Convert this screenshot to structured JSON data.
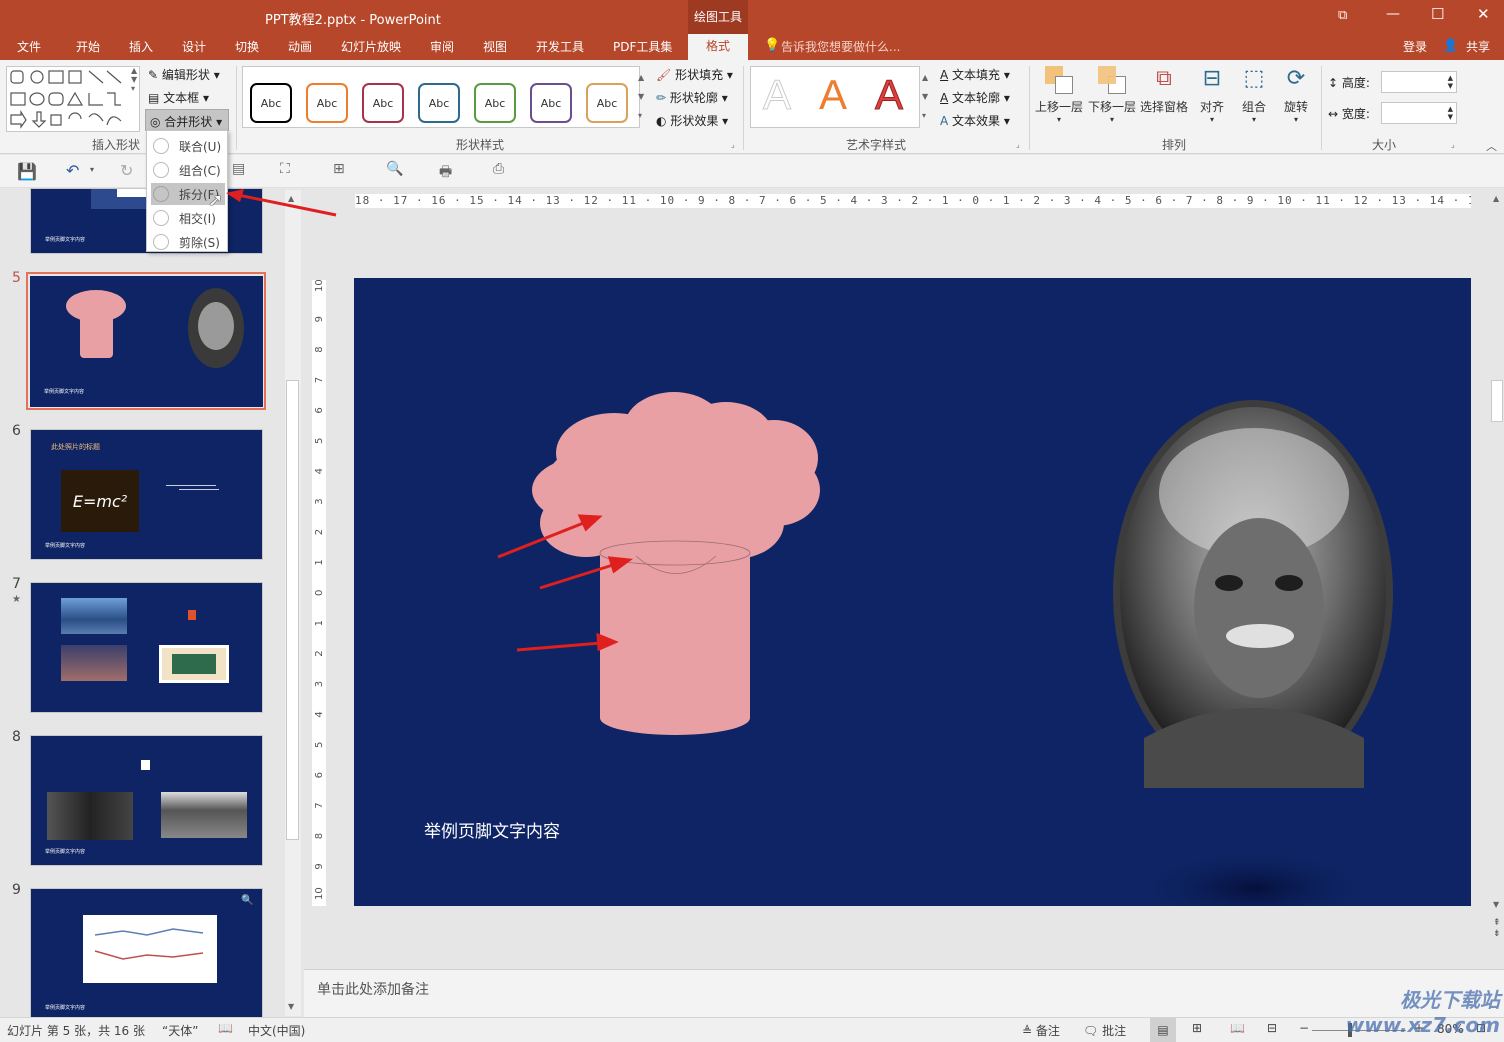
{
  "window": {
    "title": "PPT教程2.pptx - PowerPoint",
    "contextual_tab": "绘图工具",
    "controls": [
      "⧉",
      "—",
      "☐",
      "✕"
    ]
  },
  "tabs": [
    "文件",
    "开始",
    "插入",
    "设计",
    "切换",
    "动画",
    "幻灯片放映",
    "审阅",
    "视图",
    "开发工具",
    "PDF工具集",
    "格式"
  ],
  "tell_me": "告诉我您想要做什么...",
  "login": "登录",
  "share": "共享",
  "ribbon": {
    "insert_shapes": {
      "label": "插入形状",
      "edit_shape": "编辑形状",
      "text_box": "文本框",
      "merge_shapes": "合并形状"
    },
    "shape_styles": {
      "label": "形状样式",
      "sample": "Abc",
      "style_colors": [
        "#000000",
        "#ed7d31",
        "#a5344a",
        "#2e6a8e",
        "#5b9b3f",
        "#6b4e8f",
        "#d9a15a"
      ],
      "fill": "形状填充",
      "outline": "形状轮廓",
      "effects": "形状效果"
    },
    "wordart": {
      "label": "艺术字样式",
      "letter": "A",
      "text_fill": "文本填充",
      "text_outline": "文本轮廓",
      "text_effects": "文本效果"
    },
    "arrange": {
      "label": "排列",
      "bring_forward": "上移一层",
      "send_backward": "下移一层",
      "selection_pane": "选择窗格",
      "align": "对齐",
      "group": "组合",
      "rotate": "旋转"
    },
    "size": {
      "label": "大小",
      "height": "高度:",
      "width": "宽度:"
    }
  },
  "merge_menu": {
    "items": [
      "联合(U)",
      "组合(C)",
      "拆分(F)",
      "相交(I)",
      "剪除(S)"
    ],
    "highlighted": "拆分(F)"
  },
  "ruler": {
    "horizontal": "18 · 17 · 16 · 15 · 14 · 13 · 12 · 11 · 10 · 9 · 8 · 7 · 6 · 5 · 4 · 3 · 2 · 1 · 0 · 1 · 2 · 3 · 4 · 5 · 6 · 7 · 8 · 9 · 10 · 11 · 12 · 13 · 14 · 15 · 16 · 17 · 18",
    "vertical": [
      "10",
      "9",
      "8",
      "7",
      "6",
      "5",
      "4",
      "3",
      "2",
      "1",
      "0",
      "1",
      "2",
      "3",
      "4",
      "5",
      "6",
      "7",
      "8",
      "9",
      "10"
    ]
  },
  "thumbnails": [
    {
      "number": "5",
      "selected": true,
      "footer": "举例页脚文字内容"
    },
    {
      "number": "6",
      "title": "此处照片的标题",
      "formula": "E=mc²",
      "footer": "举例页脚文字内容"
    },
    {
      "number": "7",
      "mark": "★"
    },
    {
      "number": "8",
      "footer": "举例页脚文字内容"
    },
    {
      "number": "9",
      "footer": "举例页脚文字内容"
    }
  ],
  "slide": {
    "footer_text": "举例页脚文字内容",
    "background": "#0e2464",
    "shape_color": "#e8a0a4"
  },
  "notes_placeholder": "单击此处添加备注",
  "status": {
    "slide_info": "幻灯片 第 5 张，共 16 张",
    "theme": "“天体”",
    "language": "中文(中国)",
    "notes": "备注",
    "comments": "批注",
    "zoom": "80%"
  },
  "watermark": "极光下载站 www.xz7.com"
}
